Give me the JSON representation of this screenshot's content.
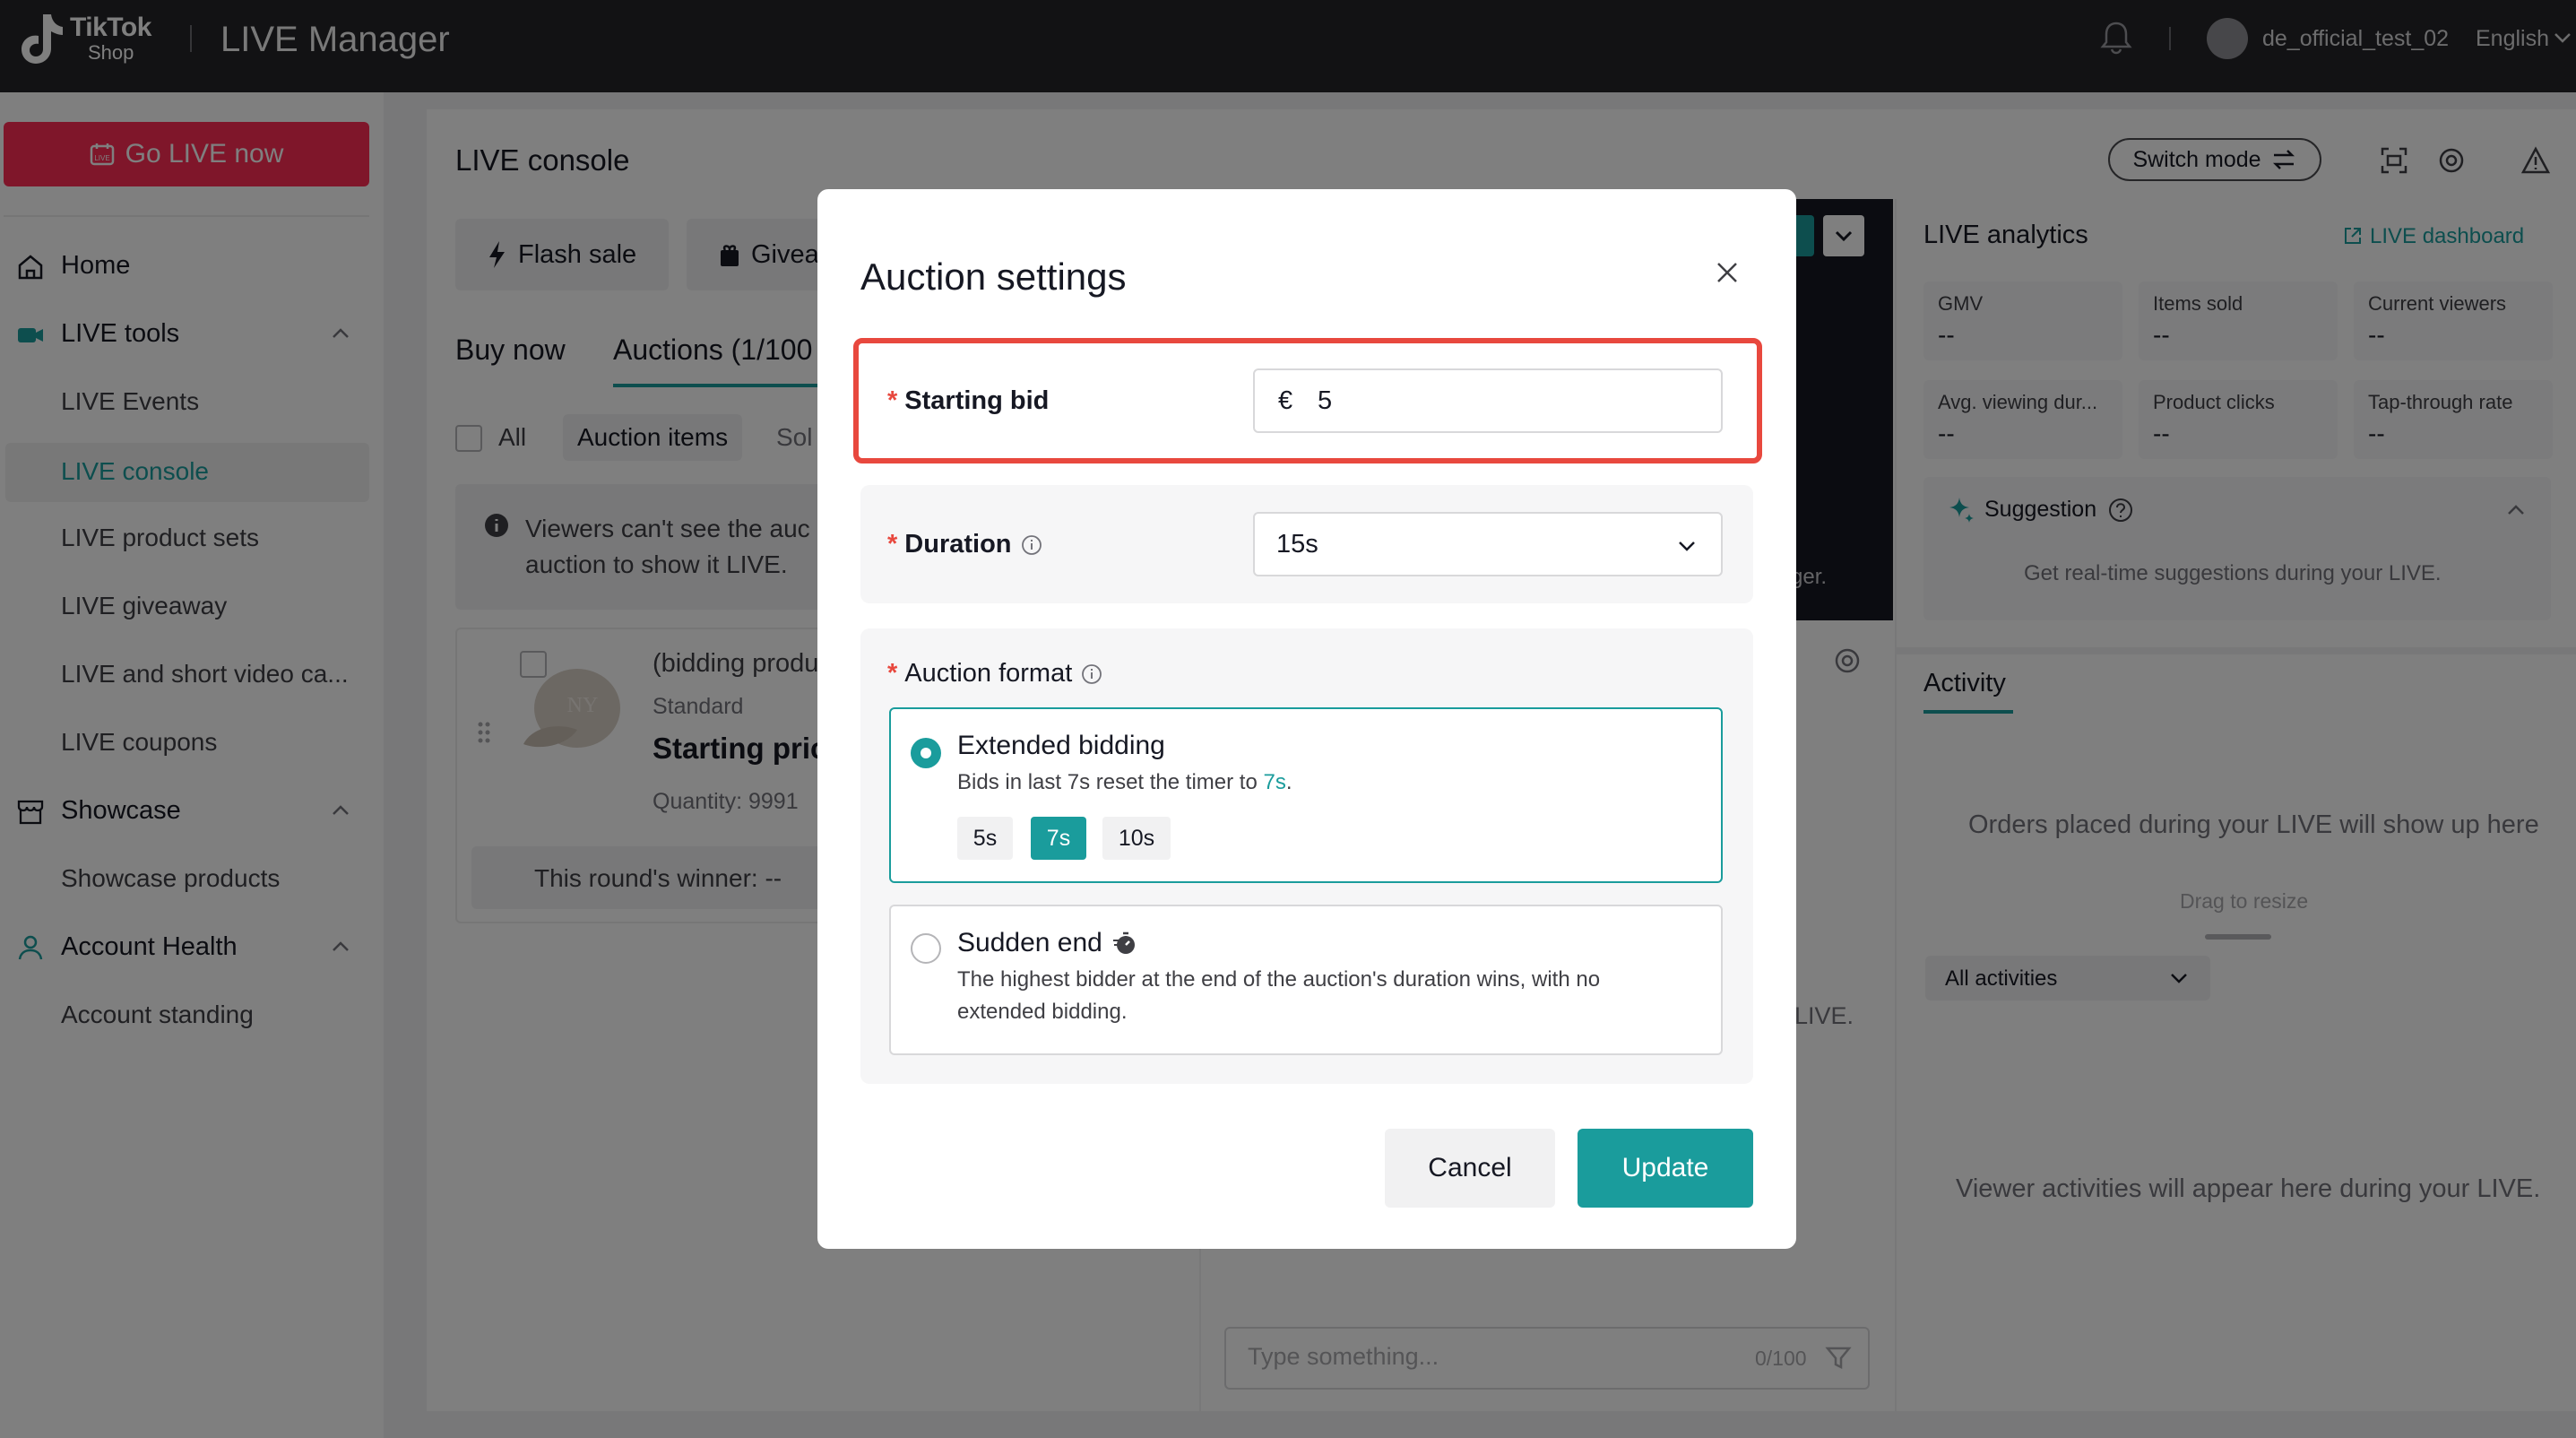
{
  "topbar": {
    "logo_line1": "TikTok",
    "logo_line2": "Shop",
    "app_title": "LIVE Manager",
    "username": "de_official_test_02",
    "language": "English"
  },
  "sidebar": {
    "go_live": "Go LIVE now",
    "items": [
      {
        "label": "Home",
        "icon": "home-icon"
      },
      {
        "label": "LIVE tools",
        "icon": "live-camera-icon"
      },
      {
        "label": "LIVE Events"
      },
      {
        "label": "LIVE console"
      },
      {
        "label": "LIVE product sets"
      },
      {
        "label": "LIVE giveaway"
      },
      {
        "label": "LIVE and short video ca..."
      },
      {
        "label": "LIVE coupons"
      },
      {
        "label": "Showcase",
        "icon": "store-icon"
      },
      {
        "label": "Showcase products"
      },
      {
        "label": "Account Health",
        "icon": "person-icon"
      },
      {
        "label": "Account standing"
      }
    ]
  },
  "console": {
    "title": "LIVE console",
    "switch_mode": "Switch mode",
    "flash_sale": "Flash sale",
    "giveaway": "Givea",
    "tab_buy_now": "Buy now",
    "tab_auctions": "Auctions (1/100",
    "filter_all": "All",
    "filter_auction_items": "Auction items",
    "filter_sold": "Sol",
    "notice_line1": "Viewers can't see the auc",
    "notice_line2": "auction to show it LIVE.",
    "product_title": "(bidding produ",
    "product_standard": "Standard",
    "product_starting_price": "Starting pric",
    "product_quantity": "Quantity: 9991",
    "winner": "This round's winner:  --"
  },
  "middle": {
    "ger_text": "ger.",
    "live_text": "LIVE.",
    "chat_placeholder": "Type something...",
    "chat_count": "0/100"
  },
  "analytics": {
    "title": "LIVE analytics",
    "dashboard_link": "LIVE dashboard",
    "metrics": [
      {
        "label": "GMV",
        "value": "--"
      },
      {
        "label": "Items sold",
        "value": "--"
      },
      {
        "label": "Current viewers",
        "value": "--"
      },
      {
        "label": "Avg. viewing dur...",
        "value": "--"
      },
      {
        "label": "Product clicks",
        "value": "--"
      },
      {
        "label": "Tap-through rate",
        "value": "--"
      }
    ],
    "suggestion_title": "Suggestion",
    "suggestion_text": "Get real-time suggestions during your LIVE."
  },
  "activity": {
    "title": "Activity",
    "orders_empty": "Orders placed during your LIVE will show up here",
    "drag_resize": "Drag to resize",
    "filter": "All activities",
    "viewers_empty": "Viewer activities will appear here during your LIVE."
  },
  "modal": {
    "title": "Auction settings",
    "starting_bid_label": "Starting bid",
    "currency": "€",
    "starting_bid_value": "5",
    "duration_label": "Duration",
    "duration_value": "15s",
    "format_label": "Auction format",
    "extended_title": "Extended bidding",
    "extended_desc_prefix": "Bids in last 7s reset the timer to ",
    "extended_desc_value": "7s",
    "extended_desc_suffix": ".",
    "timer_options": [
      "5s",
      "7s",
      "10s"
    ],
    "timer_selected": "7s",
    "sudden_title": "Sudden end",
    "sudden_desc_line1": "The highest bidder at the end of the auction's duration wins, with no",
    "sudden_desc_line2": "extended bidding.",
    "cancel": "Cancel",
    "update": "Update"
  },
  "colors": {
    "accent": "#1a9c9c",
    "brand_red": "#fe2c55",
    "highlight": "#e8483e"
  }
}
